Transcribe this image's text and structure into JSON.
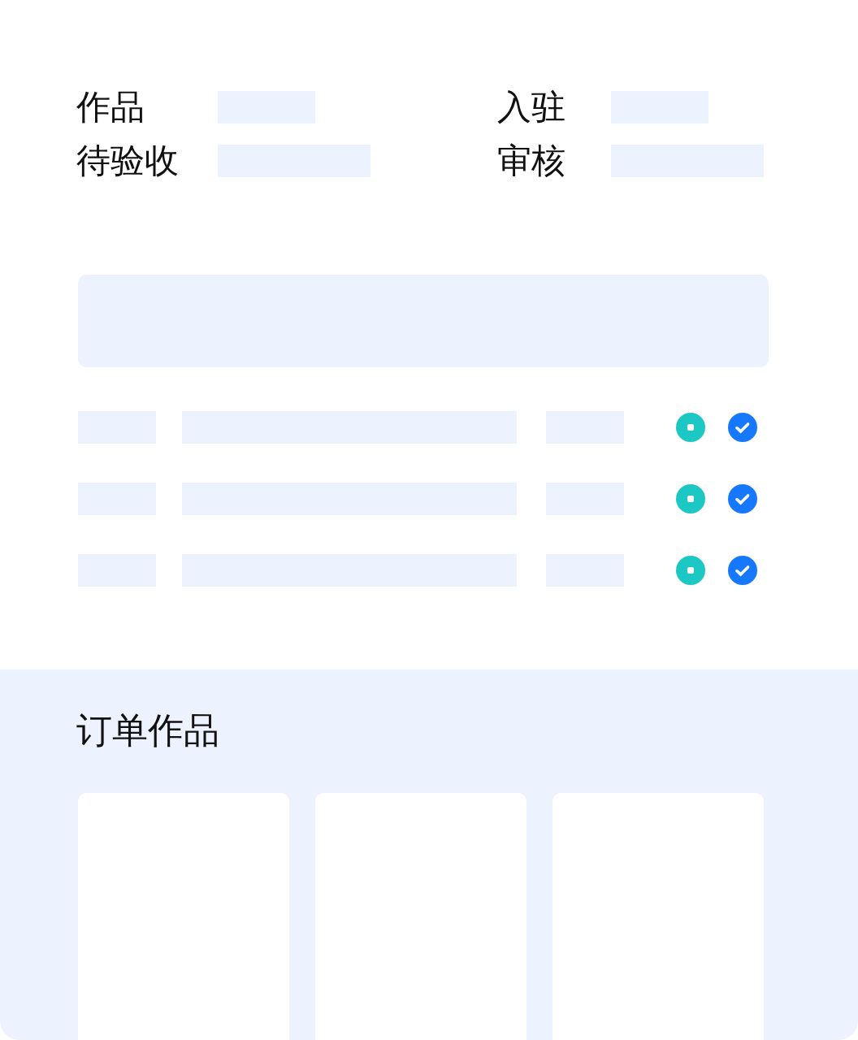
{
  "stats": [
    {
      "label": "作品",
      "kind": "short"
    },
    {
      "label": "入驻",
      "kind": "short"
    },
    {
      "label": "待验收",
      "kind": "long"
    },
    {
      "label": "审核",
      "kind": "long"
    }
  ],
  "rows": [
    {
      "kind": "skeleton"
    },
    {
      "kind": "skeleton"
    },
    {
      "kind": "skeleton"
    }
  ],
  "orders": {
    "title": "订单作品",
    "cards": [
      {
        "kind": "blank"
      },
      {
        "kind": "blank"
      },
      {
        "kind": "blank"
      }
    ]
  }
}
